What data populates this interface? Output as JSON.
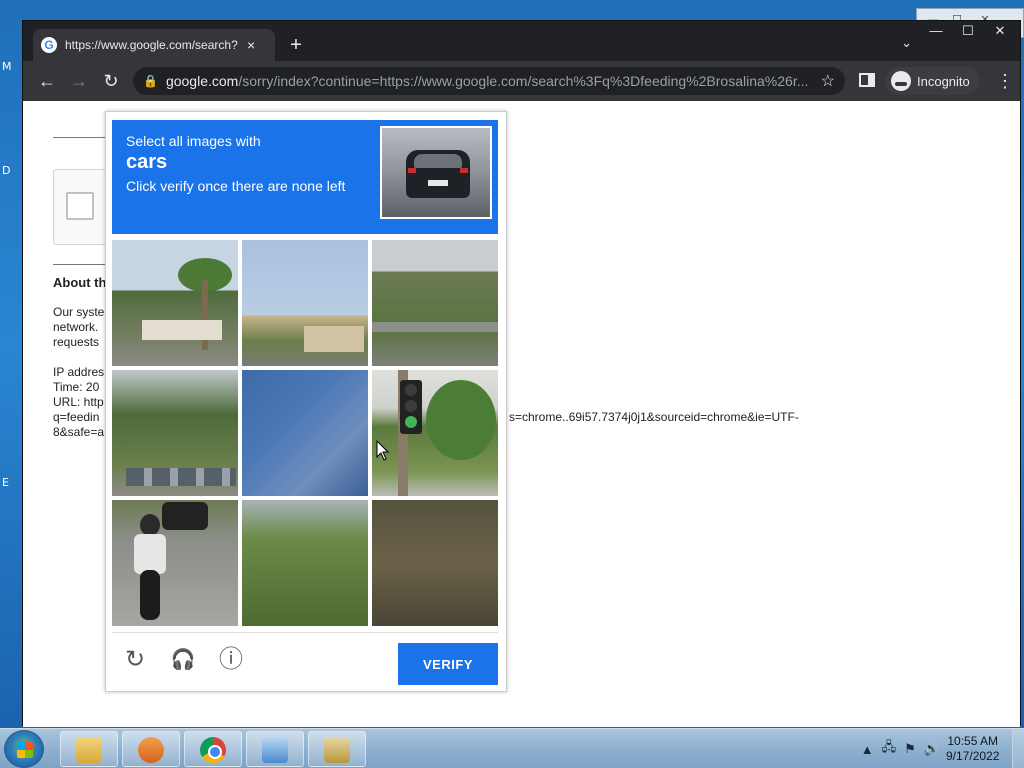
{
  "desktop": {
    "edge_letters": [
      "M",
      "D",
      "E"
    ]
  },
  "browser": {
    "tab": {
      "title": "https://www.google.com/search?",
      "favicon": "G",
      "close": "×"
    },
    "new_tab": "+",
    "tab_dropdown": "⌄",
    "window_controls": {
      "minimize": "—",
      "maximize": "☐",
      "close": "✕"
    },
    "nav": {
      "back": "←",
      "forward": "→",
      "reload": "↻"
    },
    "omnibox": {
      "lock": "🔒",
      "host": "google.com",
      "path": "/sorry/index?continue=https://www.google.com/search%3Fq%3Dfeeding%2Brosalina%26r...",
      "star": "☆"
    },
    "incognito_label": "Incognito",
    "menu": "⋮"
  },
  "page": {
    "about_title": "About th",
    "lines": [
      "Our syste",
      "network.",
      "requests",
      "",
      "IP addres",
      "Time: 20",
      "URL: http",
      "q=feedin",
      "8&safe=a"
    ],
    "url_tail": "s=chrome..69i57.7374j0j1&sourceid=chrome&ie=UTF-"
  },
  "captcha": {
    "instruction_line1": "Select all images with",
    "target": "cars",
    "instruction_line3": "Click verify once there are none left",
    "tiles": [
      {
        "id": 1,
        "label": "palm trees and house"
      },
      {
        "id": 2,
        "label": "sky and building"
      },
      {
        "id": 3,
        "label": "roadside greenery"
      },
      {
        "id": 4,
        "label": "trees and parked cars"
      },
      {
        "id": 5,
        "label": "blue building wall"
      },
      {
        "id": 6,
        "label": "traffic light"
      },
      {
        "id": 7,
        "label": "motorcycle rider and car"
      },
      {
        "id": 8,
        "label": "bushes"
      },
      {
        "id": 9,
        "label": "dark foliage"
      }
    ],
    "footer": {
      "reload_icon": "↻",
      "audio_icon": "🎧",
      "info_icon": "ⓘ",
      "verify_label": "VERIFY"
    }
  },
  "taskbar": {
    "clock_time": "10:55 AM",
    "clock_date": "9/17/2022",
    "tray_arrow": "▲"
  }
}
